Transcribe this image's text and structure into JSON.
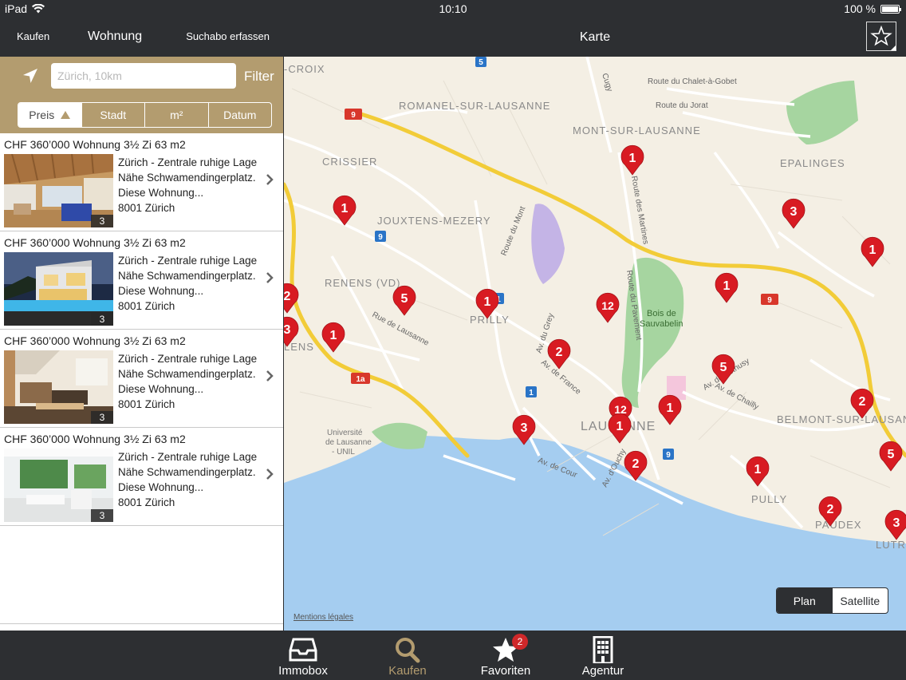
{
  "status_bar": {
    "device": "iPad",
    "time": "10:10",
    "battery": "100 %"
  },
  "left_nav": {
    "back_label": "Kaufen",
    "title": "Wohnung",
    "action_label": "Suchabo erfassen"
  },
  "search": {
    "placeholder": "Zürich, 10km",
    "filter_label": "Filter"
  },
  "sort": {
    "options": [
      "Preis",
      "Stadt",
      "m²",
      "Datum"
    ],
    "active": "Preis",
    "direction": "ascending"
  },
  "listings": [
    {
      "headline": "CHF 360’000 Wohnung 3½ Zi 63 m2",
      "line1": "Zürich - Zentrale ruhige Lage",
      "line2": "Nähe Schwamendingerplatz.",
      "line3": "Diese Wohnung...",
      "line4": "8001 Zürich",
      "photo_count": "3"
    },
    {
      "headline": "CHF 360’000 Wohnung 3½ Zi 63 m2",
      "line1": "Zürich - Zentrale ruhige Lage",
      "line2": "Nähe Schwamendingerplatz.",
      "line3": "Diese Wohnung...",
      "line4": "8001 Zürich",
      "photo_count": "3"
    },
    {
      "headline": "CHF 360’000 Wohnung 3½ Zi 63 m2",
      "line1": "Zürich - Zentrale ruhige Lage",
      "line2": "Nähe Schwamendingerplatz.",
      "line3": "Diese Wohnung...",
      "line4": "8001 Zürich",
      "photo_count": "3"
    },
    {
      "headline": "CHF 360’000 Wohnung 3½ Zi 63 m2",
      "line1": "Zürich - Zentrale ruhige Lage",
      "line2": "Nähe Schwamendingerplatz.",
      "line3": "Diese Wohnung...",
      "line4": "8001 Zürich",
      "photo_count": "3"
    }
  ],
  "right_nav": {
    "title": "Karte"
  },
  "map": {
    "place_labels": [
      "-CROIX",
      "ROMANEL-SUR-LAUSANNE",
      "MONT-SUR-LAUSANNE",
      "CRISSIER",
      "EPALINGES",
      "JOUXTENS-MEZERY",
      "RENENS (VD)",
      "PRILLY",
      "Bois de",
      "Sauvabelin",
      "LAUSANNE",
      "BELMONT-SUR-LAUSAN",
      "PULLY",
      "PAUDEX",
      "LUTR",
      "LENS",
      "Université",
      "de Lausanne",
      "- UNIL"
    ],
    "street_labels": [
      "Route du Chalet-à-Gobet",
      "Route du Jorat",
      "Route du Mont",
      "Route des Martines",
      "Route du Pavement",
      "Rue de Lausanne",
      "Av. du Grey",
      "Av. de France",
      "Av. de Béthusy",
      "Av. de Chailly",
      "Av. de Cour",
      "Av. d'Ouchy",
      "Cugy"
    ],
    "road_shields": [
      "9",
      "5",
      "9",
      "9",
      "1a",
      "1",
      "1",
      "9"
    ],
    "pin_counts": [
      "1",
      "1",
      "3",
      "1",
      "1",
      "5",
      "1",
      "12",
      "1",
      "2",
      "5",
      "2",
      "12",
      "1",
      "1",
      "3",
      "2",
      "1",
      "5",
      "2",
      "3",
      "3",
      "2"
    ],
    "legal_label": "Mentions légales",
    "mode_options": [
      "Plan",
      "Satellite"
    ],
    "active_mode": "Plan",
    "colors": {
      "water": "#a5cdf0",
      "land": "#f4efe4",
      "park": "#a6d5a0",
      "road": "#ffffff",
      "highway": "#f2cc38",
      "pin": "#d81b22"
    }
  },
  "tabbar": {
    "tabs": [
      {
        "label": "Immobox",
        "icon": "inbox-icon"
      },
      {
        "label": "Kaufen",
        "icon": "search-icon"
      },
      {
        "label": "Favoriten",
        "icon": "star-icon",
        "badge": "2"
      },
      {
        "label": "Agentur",
        "icon": "building-icon"
      }
    ],
    "active": "Kaufen"
  },
  "colors": {
    "brand": "#b39c6f",
    "bars": "#2d2f32"
  }
}
